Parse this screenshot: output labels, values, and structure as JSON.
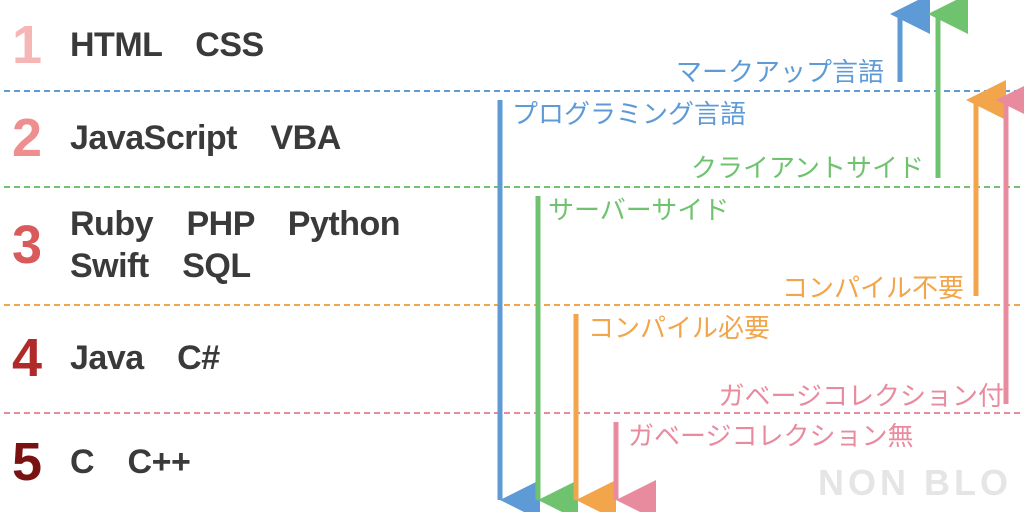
{
  "rows": [
    {
      "num": "1",
      "langs": "HTML　CSS"
    },
    {
      "num": "2",
      "langs": "JavaScript　VBA"
    },
    {
      "num": "3",
      "langs": "Ruby　PHP　Python\nSwift　SQL"
    },
    {
      "num": "4",
      "langs": "Java　C#"
    },
    {
      "num": "5",
      "langs": "C　C++"
    }
  ],
  "labels": {
    "markup": "マークアップ言語",
    "programming": "プログラミング言語",
    "client": "クライアントサイド",
    "server": "サーバーサイド",
    "compile_no": "コンパイル不要",
    "compile_yes": "コンパイル必要",
    "gc_yes": "ガベージコレクション付",
    "gc_no": "ガベージコレクション無"
  },
  "colors": {
    "blue": "#5e9bd6",
    "green": "#6fc36f",
    "orange": "#f2a54a",
    "pink": "#e98b9e"
  },
  "watermark": "NON BLO"
}
